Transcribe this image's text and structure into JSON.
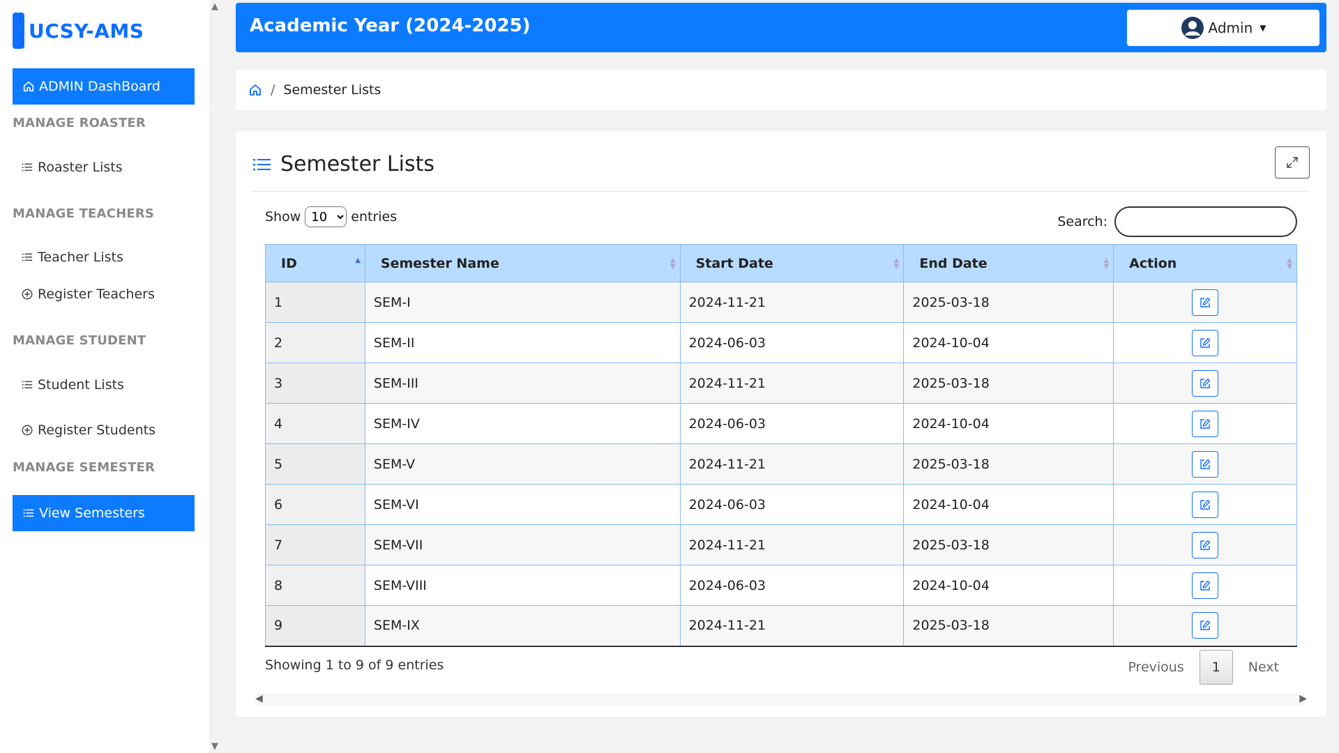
{
  "brand": {
    "name": "UCSY-AMS"
  },
  "sidebar": {
    "dashboard": "ADMIN DashBoard",
    "sections": {
      "roaster": "MANAGE ROASTER",
      "teachers": "MANAGE TEACHERS",
      "student": "MANAGE STUDENT",
      "semester": "MANAGE SEMESTER"
    },
    "links": {
      "roaster_lists": "Roaster Lists",
      "teacher_lists": "Teacher Lists",
      "register_teachers": "Register Teachers",
      "student_lists": "Student Lists",
      "register_students": "Register Students",
      "view_semesters": "View Semesters"
    }
  },
  "header": {
    "title": "Academic Year (2024-2025)",
    "user": "Admin"
  },
  "breadcrumb": {
    "current": "Semester Lists",
    "separator": "/"
  },
  "card": {
    "title": "Semester Lists",
    "show_label": "Show",
    "entries_label": "entries",
    "page_length": "10",
    "search_label": "Search:",
    "search_value": ""
  },
  "table": {
    "columns": [
      "ID",
      "Semester Name",
      "Start Date",
      "End Date",
      "Action"
    ],
    "rows": [
      {
        "id": "1",
        "name": "SEM-I",
        "start": "2024-11-21",
        "end": "2025-03-18"
      },
      {
        "id": "2",
        "name": "SEM-II",
        "start": "2024-06-03",
        "end": "2024-10-04"
      },
      {
        "id": "3",
        "name": "SEM-III",
        "start": "2024-11-21",
        "end": "2025-03-18"
      },
      {
        "id": "4",
        "name": "SEM-IV",
        "start": "2024-06-03",
        "end": "2024-10-04"
      },
      {
        "id": "5",
        "name": "SEM-V",
        "start": "2024-11-21",
        "end": "2025-03-18"
      },
      {
        "id": "6",
        "name": "SEM-VI",
        "start": "2024-06-03",
        "end": "2024-10-04"
      },
      {
        "id": "7",
        "name": "SEM-VII",
        "start": "2024-11-21",
        "end": "2025-03-18"
      },
      {
        "id": "8",
        "name": "SEM-VIII",
        "start": "2024-06-03",
        "end": "2024-10-04"
      },
      {
        "id": "9",
        "name": "SEM-IX",
        "start": "2024-11-21",
        "end": "2025-03-18"
      }
    ]
  },
  "footer": {
    "info": "Showing 1 to 9 of 9 entries",
    "previous": "Previous",
    "current_page": "1",
    "next": "Next"
  },
  "colors": {
    "primary": "#0d7bff",
    "header_row": "#b8dcff"
  }
}
